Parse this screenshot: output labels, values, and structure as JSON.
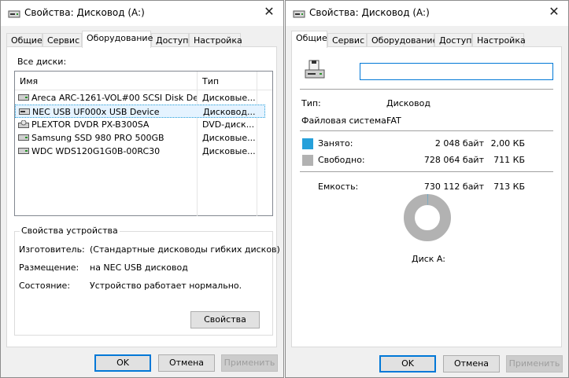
{
  "dialog_left": {
    "title": "Свойства: Дисковод (A:)",
    "tabs": [
      "Общие",
      "Сервис",
      "Оборудование",
      "Доступ",
      "Настройка"
    ],
    "all_disks_label": "Все диски:",
    "columns": {
      "name": "Имя",
      "type": "Тип"
    },
    "disks": [
      {
        "name": "Areca ARC-1261-VOL#00 SCSI Disk De...",
        "type": "Дисковые..."
      },
      {
        "name": "NEC USB UF000x USB Device",
        "type": "Дисковод..."
      },
      {
        "name": "PLEXTOR DVDR   PX-B300SA",
        "type": "DVD-диск..."
      },
      {
        "name": "Samsung SSD 980 PRO 500GB",
        "type": "Дисковые..."
      },
      {
        "name": "WDC WDS120G1G0B-00RC30",
        "type": "Дисковые..."
      }
    ],
    "selected_index": 1,
    "device_props": {
      "title": "Свойства устройства",
      "manufacturer_label": "Изготовитель:",
      "manufacturer_value": "(Стандартные дисководы гибких дисков)",
      "location_label": "Размещение:",
      "location_value": "на NEC USB дисковод",
      "status_label": "Состояние:",
      "status_value": "Устройство работает нормально.",
      "properties_button": "Свойства"
    },
    "buttons": {
      "ok": "OK",
      "cancel": "Отмена",
      "apply": "Применить"
    }
  },
  "dialog_right": {
    "title": "Свойства: Дисковод (A:)",
    "tabs": [
      "Общие",
      "Сервис",
      "Оборудование",
      "Доступ",
      "Настройка"
    ],
    "name_input_value": "",
    "type_label": "Тип:",
    "type_value": "Дисковод",
    "fs_label": "Файловая система:",
    "fs_value": "FAT",
    "used_label": "Занято:",
    "used_bytes": "2 048 байт",
    "used_size": "2,00 КБ",
    "free_label": "Свободно:",
    "free_bytes": "728 064 байт",
    "free_size": "711 КБ",
    "capacity_label": "Емкость:",
    "capacity_bytes": "730 112 байт",
    "capacity_size": "713 КБ",
    "used_fraction": 0.0028,
    "disk_label": "Диск A:",
    "buttons": {
      "ok": "OK",
      "cancel": "Отмена",
      "apply": "Применить"
    }
  },
  "colors": {
    "used": "#26a0da",
    "free": "#b2b2b2",
    "accent": "#0078d7"
  },
  "icons": {
    "title": "drive-icon",
    "close": "close-icon",
    "floppy": "floppy-drive-icon"
  }
}
